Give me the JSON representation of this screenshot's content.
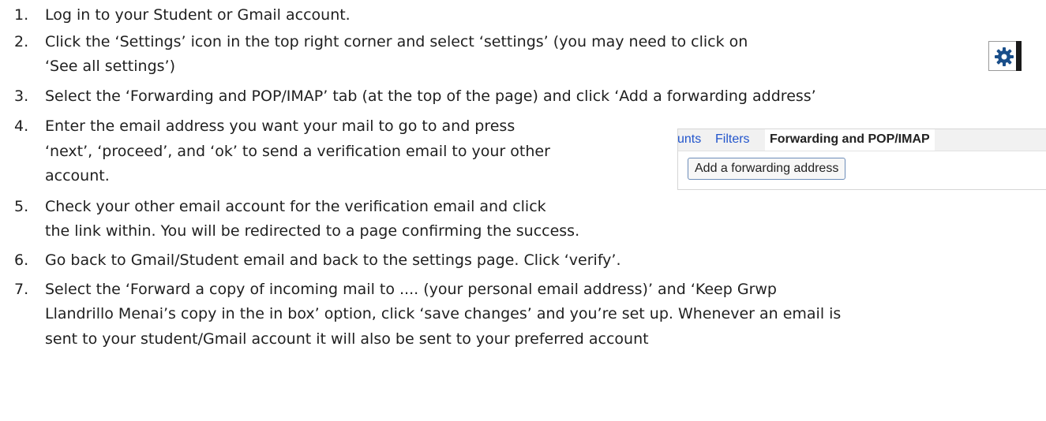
{
  "steps": [
    {
      "num": "1.",
      "lines": [
        "Log in to your Student or Gmail account."
      ]
    },
    {
      "num": "2.",
      "lines": [
        "Click the ‘Settings’ icon in the top right corner and select ‘settings’ (you may need to click on",
        "‘See all settings’)"
      ]
    },
    {
      "num": "3.",
      "lines": [
        "Select the ‘Forwarding and POP/IMAP’ tab (at the top of the page) and click ‘Add a forwarding address’"
      ]
    },
    {
      "num": "4.",
      "lines": [
        "Enter the email address you want your mail to go to and press",
        "‘next’, ‘proceed’, and ‘ok’ to send a verification email to your other",
        "account."
      ]
    },
    {
      "num": "5.",
      "lines": [
        "Check your other email account for the verification email and click",
        "the link within. You will be redirected to a page confirming the success."
      ]
    },
    {
      "num": "6.",
      "lines": [
        "Go back to Gmail/Student email and back to the settings page. Click ‘verify’."
      ]
    },
    {
      "num": "7.",
      "lines": [
        "Select the ‘Forward a copy of incoming mail to .... (your personal email address)’ and ‘Keep Grwp",
        "Llandrillo Menai’s copy in the in box’ option, click ‘save changes’ and you’re set up. Whenever an email is",
        "sent to your student/Gmail account it will also be sent to your preferred account"
      ]
    }
  ],
  "settings_image": {
    "icon": "gear-icon"
  },
  "forwarding_image": {
    "tabs": [
      "unts",
      "Filters",
      "Forwarding and POP/IMAP"
    ],
    "button_label": "Add a forwarding address"
  },
  "colors": {
    "text": "#1f1f1f",
    "tab_link": "#2255cc",
    "gear": "#1a4f8a"
  }
}
